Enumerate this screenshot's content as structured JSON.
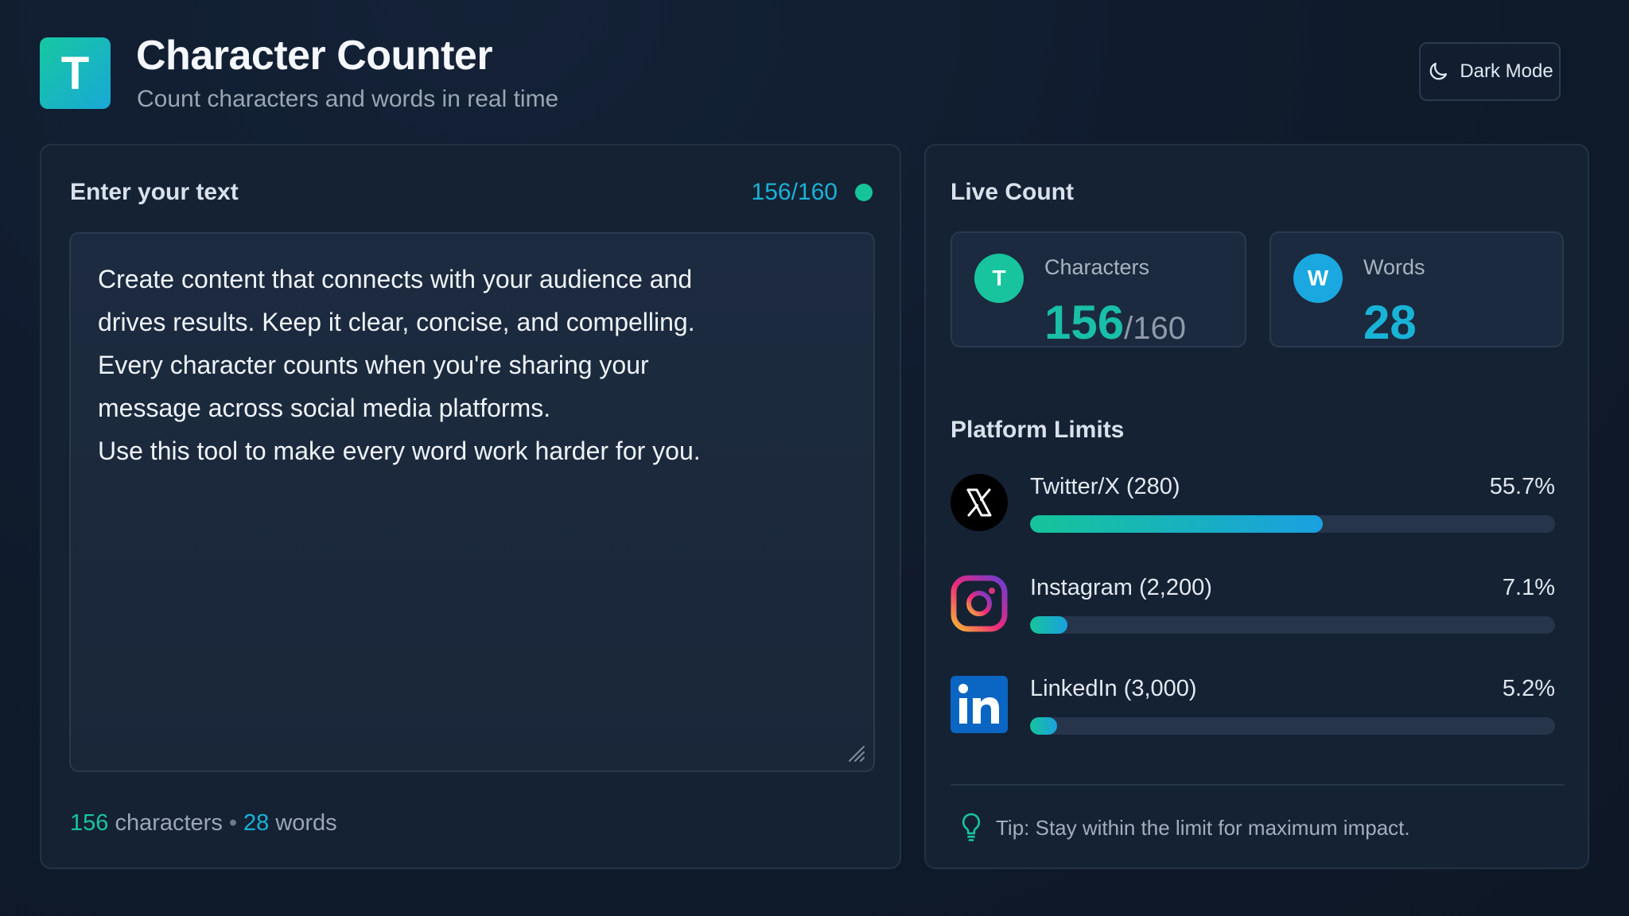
{
  "header": {
    "logo_letter": "T",
    "title": "Character Counter",
    "subtitle": "Count characters and words in real time",
    "dark_mode_label": "Dark Mode",
    "dark_mode_icon": "moon-icon"
  },
  "editor": {
    "title": "Enter your text",
    "limit_display": "156/160",
    "status_color": "#16c49a",
    "lines": [
      "Create content that connects with your audience and",
      "drives results. Keep it clear, concise, and compelling.",
      "Every character counts when you're sharing your",
      "message across social media platforms.",
      "Use this tool to make every word work harder for you."
    ],
    "footer": {
      "char_count": "156",
      "char_label": " characters",
      "separator": "•",
      "word_count": "28",
      "word_label": " words"
    }
  },
  "live_count": {
    "title": "Live Count",
    "characters": {
      "badge": "T",
      "label": "Characters",
      "value": "156",
      "limit": "/160"
    },
    "words": {
      "badge": "W",
      "label": "Words",
      "value": "28"
    }
  },
  "platform_limits": {
    "title": "Platform Limits",
    "items": [
      {
        "name": "Twitter/X (280)",
        "percent_label": "55.7%",
        "fill_percent": 55.7,
        "icon": "x-logo-icon"
      },
      {
        "name": "Instagram (2,200)",
        "percent_label": "7.1%",
        "fill_percent": 7.1,
        "icon": "instagram-icon"
      },
      {
        "name": "LinkedIn (3,000)",
        "percent_label": "5.2%",
        "fill_percent": 5.2,
        "icon": "linkedin-icon"
      }
    ]
  },
  "tip": {
    "icon": "lightbulb-icon",
    "text": "Tip: Stay within the limit for maximum impact."
  },
  "colors": {
    "accent_green": "#16c49a",
    "accent_blue": "#1ab2d6",
    "background": "#0f1a2b",
    "card": "#152234"
  }
}
